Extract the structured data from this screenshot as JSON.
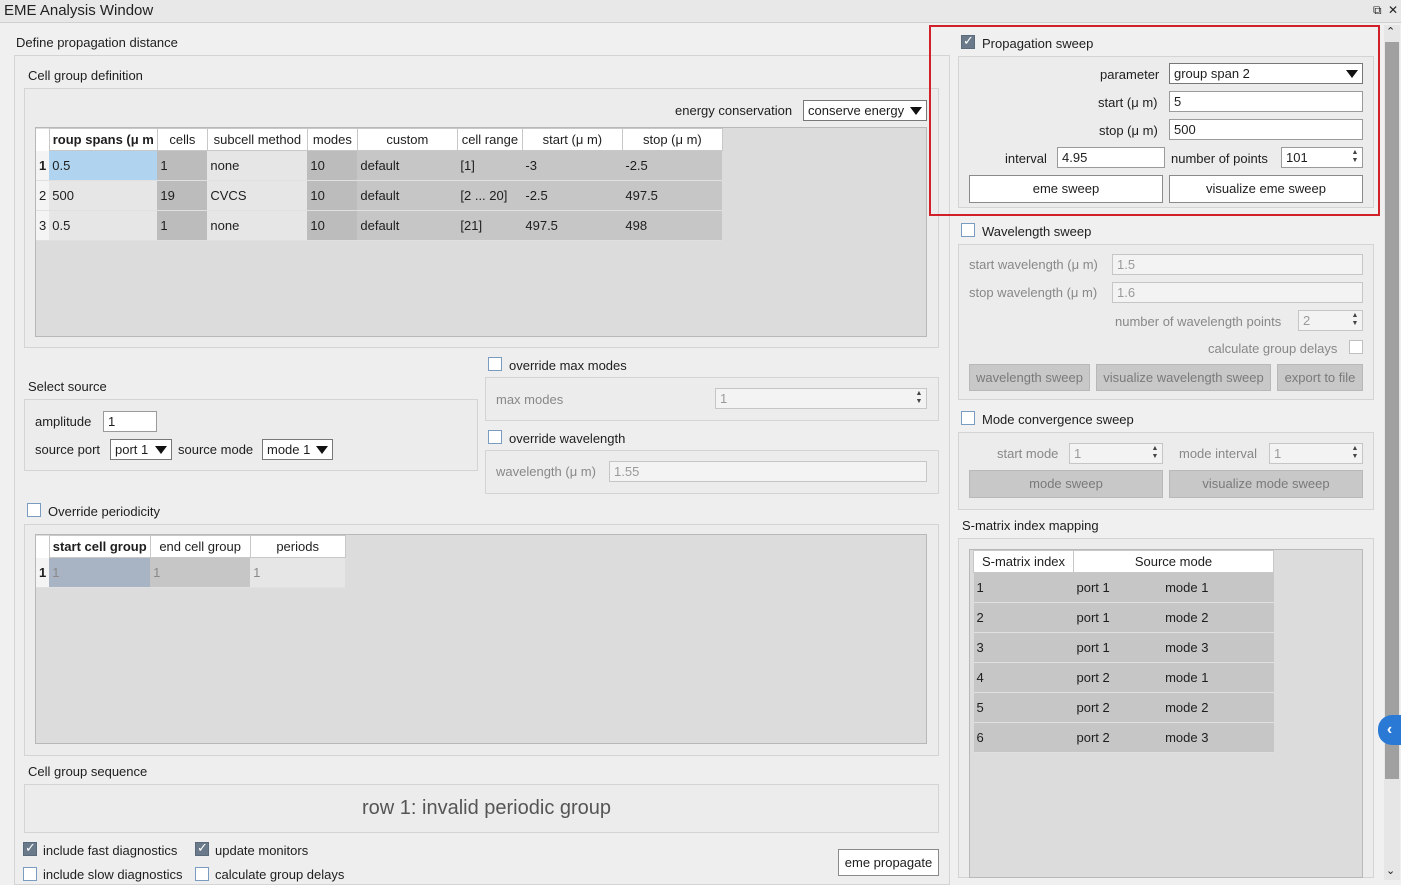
{
  "window": {
    "title": "EME Analysis Window"
  },
  "left": {
    "define_label": "Define propagation distance",
    "cell_group_label": "Cell group definition",
    "energy_conservation_label": "energy conservation",
    "energy_conservation_value": "conserve energy",
    "cell_table": {
      "headers": [
        "roup spans (μ m",
        "cells",
        "subcell method",
        "modes",
        "custom",
        "cell range",
        "start (μ m)",
        "stop (μ m)"
      ],
      "rows": [
        {
          "n": "1",
          "span": "0.5",
          "cells": "1",
          "subcell": "none",
          "modes": "10",
          "custom": "default",
          "range": "[1]",
          "start": "-3",
          "stop": "-2.5"
        },
        {
          "n": "2",
          "span": "500",
          "cells": "19",
          "subcell": "CVCS",
          "modes": "10",
          "custom": "default",
          "range": "[2 ... 20]",
          "start": "-2.5",
          "stop": "497.5"
        },
        {
          "n": "3",
          "span": "0.5",
          "cells": "1",
          "subcell": "none",
          "modes": "10",
          "custom": "default",
          "range": "[21]",
          "start": "497.5",
          "stop": "498"
        }
      ]
    },
    "select_source_label": "Select source",
    "amplitude_label": "amplitude",
    "amplitude_value": "1",
    "source_port_label": "source port",
    "source_port_value": "port 1",
    "source_mode_label": "source mode",
    "source_mode_value": "mode 1",
    "override_max_modes_label": "override max modes",
    "max_modes_label": "max modes",
    "max_modes_value": "1",
    "override_wavelength_label": "override wavelength",
    "wavelength_label": "wavelength (μ m)",
    "wavelength_value": "1.55",
    "override_periodicity_label": "Override periodicity",
    "period_table": {
      "headers": [
        "start cell group",
        "end cell group",
        "periods"
      ],
      "rows": [
        {
          "n": "1",
          "start": "1",
          "end": "1",
          "periods": "1"
        }
      ]
    },
    "cell_group_sequence_label": "Cell group sequence",
    "sequence_message": "row 1: invalid periodic group",
    "include_fast_label": "include fast diagnostics",
    "update_monitors_label": "update monitors",
    "include_slow_label": "include slow diagnostics",
    "calc_group_delays_label": "calculate group delays",
    "eme_propagate_label": "eme propagate"
  },
  "right": {
    "prop_sweep_label": "Propagation sweep",
    "parameter_label": "parameter",
    "parameter_value": "group span 2",
    "start_label": "start (μ m)",
    "start_value": "5",
    "stop_label": "stop (μ m)",
    "stop_value": "500",
    "interval_label": "interval",
    "interval_value": "4.95",
    "num_points_label": "number of points",
    "num_points_value": "101",
    "eme_sweep_label": "eme sweep",
    "visualize_eme_sweep_label": "visualize eme sweep",
    "wl_sweep_label": "Wavelength sweep",
    "start_wl_label": "start wavelength (μ m)",
    "start_wl_value": "1.5",
    "stop_wl_label": "stop wavelength (μ m)",
    "stop_wl_value": "1.6",
    "num_wl_points_label": "number of wavelength points",
    "num_wl_points_value": "2",
    "calc_group_delays_label": "calculate group delays",
    "wavelength_sweep_btn": "wavelength sweep",
    "visualize_wl_sweep_btn": "visualize wavelength sweep",
    "export_btn": "export to file",
    "mode_conv_label": "Mode convergence sweep",
    "start_mode_label": "start mode",
    "start_mode_value": "1",
    "mode_interval_label": "mode interval",
    "mode_interval_value": "1",
    "mode_sweep_btn": "mode sweep",
    "visualize_mode_sweep_btn": "visualize mode sweep",
    "smatrix_label": "S-matrix index mapping",
    "smatrix_headers": [
      "S-matrix index",
      "Source mode"
    ],
    "smatrix_rows": [
      {
        "idx": "1",
        "port": "port 1",
        "mode": "mode 1"
      },
      {
        "idx": "2",
        "port": "port 1",
        "mode": "mode 2"
      },
      {
        "idx": "3",
        "port": "port 1",
        "mode": "mode 3"
      },
      {
        "idx": "4",
        "port": "port 2",
        "mode": "mode 1"
      },
      {
        "idx": "5",
        "port": "port 2",
        "mode": "mode 2"
      },
      {
        "idx": "6",
        "port": "port 2",
        "mode": "mode 3"
      }
    ]
  },
  "icons": {
    "restore": "restore-icon",
    "close": "close-icon",
    "collapse": "chevron-left-icon"
  },
  "colors": {
    "highlight_box": "#d0202a",
    "selected_cell": "#b0d4f0",
    "collapse_tab": "#2a7ad5"
  }
}
